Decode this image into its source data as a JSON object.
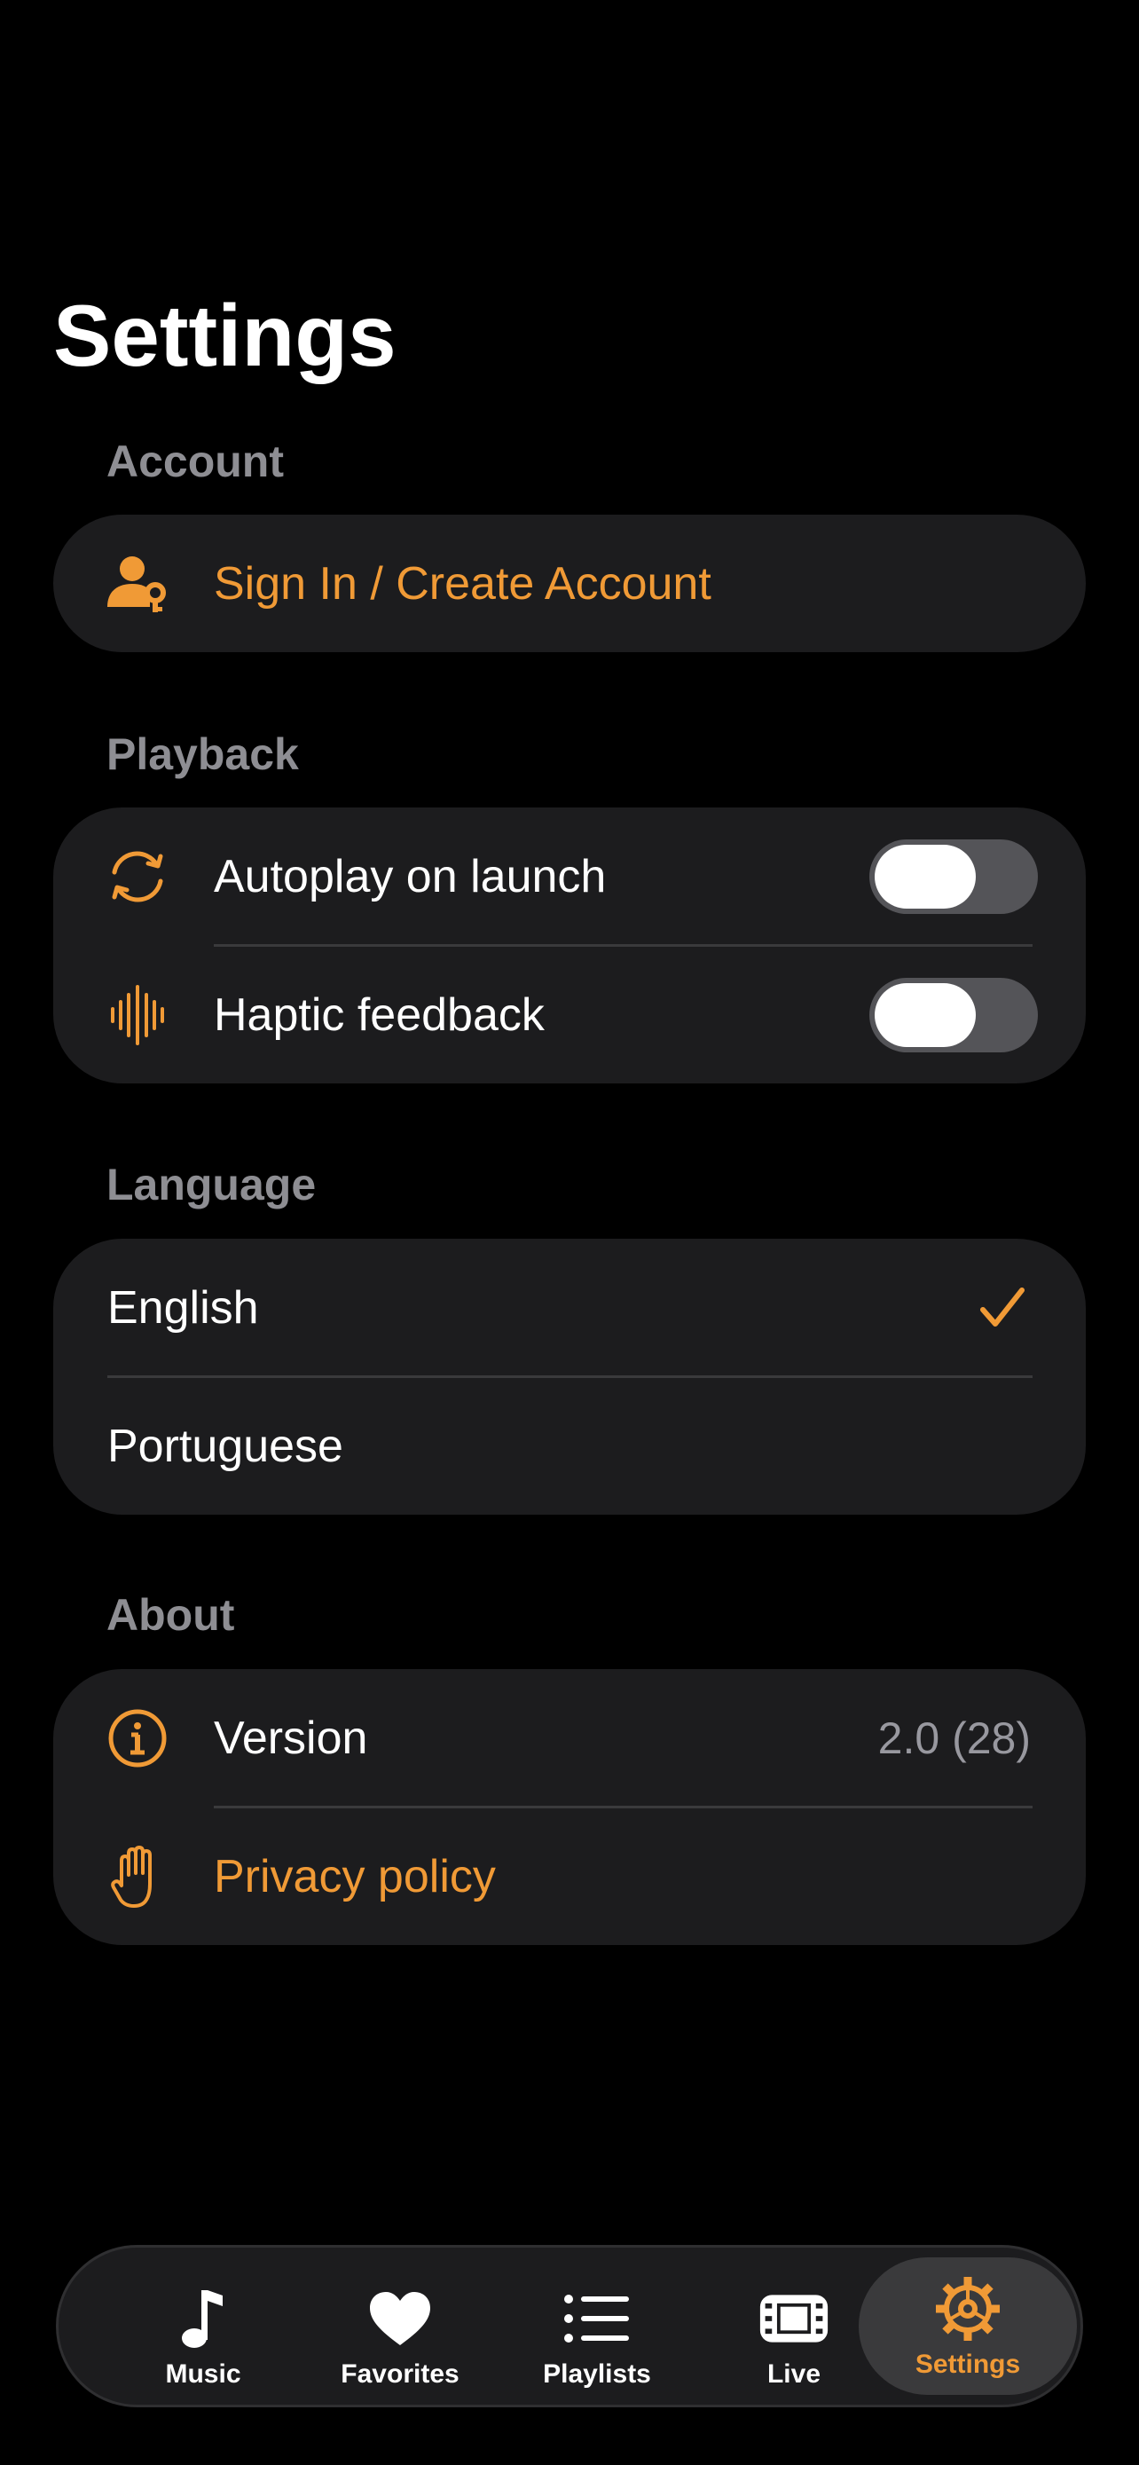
{
  "header": {
    "title": "Settings"
  },
  "sections": {
    "account": {
      "header": "Account",
      "sign_in_label": "Sign In / Create Account"
    },
    "playback": {
      "header": "Playback",
      "autoplay_label": "Autoplay on launch",
      "autoplay_on": false,
      "haptic_label": "Haptic feedback",
      "haptic_on": false
    },
    "language": {
      "header": "Language",
      "options": [
        "English",
        "Portuguese"
      ],
      "selected": "English"
    },
    "about": {
      "header": "About",
      "version_label": "Version",
      "version_value": "2.0 (28)",
      "privacy_label": "Privacy policy"
    }
  },
  "tab_bar": {
    "tabs": [
      {
        "label": "Music",
        "icon": "music-note-icon"
      },
      {
        "label": "Favorites",
        "icon": "heart-icon"
      },
      {
        "label": "Playlists",
        "icon": "list-icon"
      },
      {
        "label": "Live",
        "icon": "film-icon"
      },
      {
        "label": "Settings",
        "icon": "gear-icon"
      }
    ],
    "active": "Settings"
  },
  "colors": {
    "accent": "#f09a36",
    "background": "#000000",
    "card": "#1c1c1e",
    "secondary_text": "#8e8e93"
  }
}
